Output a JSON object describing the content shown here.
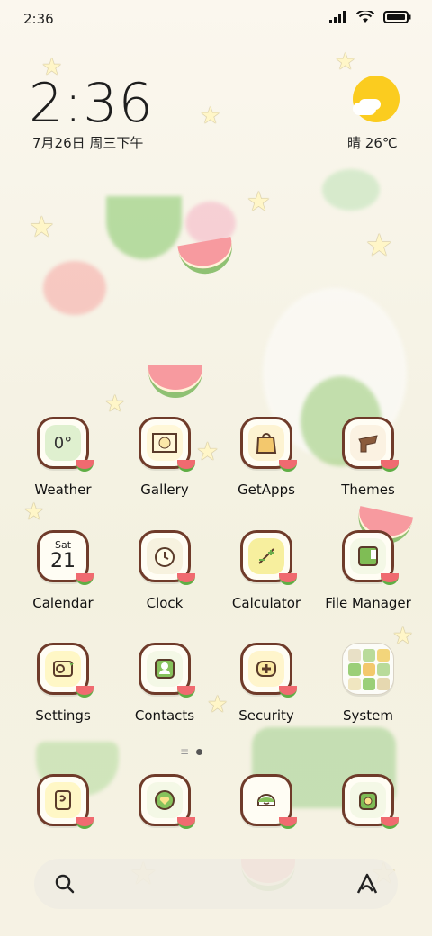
{
  "status_bar": {
    "time": "2:36"
  },
  "clock_widget": {
    "time": "2:36",
    "date": "7月26日 周三下午"
  },
  "weather_widget": {
    "condition": "晴",
    "temp": "26℃",
    "icon": "sunny-cloud-icon"
  },
  "apps": [
    {
      "label": "Weather",
      "icon": "weather-icon",
      "icon_text": "0°"
    },
    {
      "label": "Gallery",
      "icon": "gallery-icon"
    },
    {
      "label": "GetApps",
      "icon": "getapps-icon"
    },
    {
      "label": "Themes",
      "icon": "themes-icon"
    },
    {
      "label": "Calendar",
      "icon": "calendar-icon",
      "icon_day": "Sat",
      "icon_date": "21"
    },
    {
      "label": "Clock",
      "icon": "clock-icon"
    },
    {
      "label": "Calculator",
      "icon": "calculator-icon"
    },
    {
      "label": "File Manager",
      "icon": "file-manager-icon"
    },
    {
      "label": "Settings",
      "icon": "settings-icon"
    },
    {
      "label": "Contacts",
      "icon": "contacts-icon"
    },
    {
      "label": "Security",
      "icon": "security-icon"
    },
    {
      "label": "System",
      "icon": "folder-icon"
    }
  ],
  "dock_apps": [
    {
      "icon": "phone-icon"
    },
    {
      "icon": "messages-icon"
    },
    {
      "icon": "browser-icon"
    },
    {
      "icon": "camera-icon"
    }
  ],
  "colors": {
    "accent": "#8fc173",
    "outline": "#6f3b2a",
    "melon": "#f06a70",
    "sun": "#fbcc1f"
  }
}
